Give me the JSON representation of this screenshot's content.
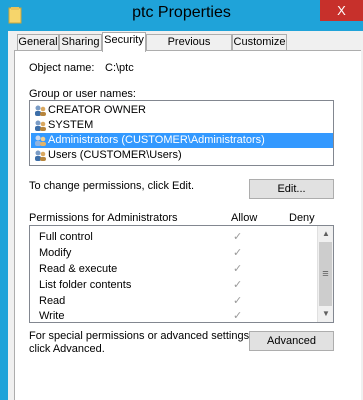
{
  "window": {
    "title": "ptc Properties",
    "close_glyph": "X"
  },
  "tabs": [
    {
      "label": "General"
    },
    {
      "label": "Sharing"
    },
    {
      "label": "Security",
      "active": true
    },
    {
      "label": "Previous Versions"
    },
    {
      "label": "Customize"
    }
  ],
  "object": {
    "label": "Object name:",
    "value": "C:\\ptc"
  },
  "groups": {
    "label": "Group or user names:",
    "items": [
      {
        "name": "CREATOR OWNER",
        "selected": false
      },
      {
        "name": "SYSTEM",
        "selected": false
      },
      {
        "name": "Administrators (CUSTOMER\\Administrators)",
        "selected": true
      },
      {
        "name": "Users (CUSTOMER\\Users)",
        "selected": false
      }
    ]
  },
  "change_note": "To change permissions, click Edit.",
  "edit_button": "Edit...",
  "permissions": {
    "label": "Permissions for Administrators",
    "allow_header": "Allow",
    "deny_header": "Deny",
    "rows": [
      {
        "name": "Full control",
        "allow": "✓",
        "deny": ""
      },
      {
        "name": "Modify",
        "allow": "✓",
        "deny": ""
      },
      {
        "name": "Read & execute",
        "allow": "✓",
        "deny": ""
      },
      {
        "name": "List folder contents",
        "allow": "✓",
        "deny": ""
      },
      {
        "name": "Read",
        "allow": "✓",
        "deny": ""
      },
      {
        "name": "Write",
        "allow": "✓",
        "deny": ""
      }
    ]
  },
  "special_note_line1": "For special permissions or advanced settings,",
  "special_note_line2": "click Advanced.",
  "advanced_button": "Advanced",
  "scroll_up_glyph": "▲",
  "scroll_down_glyph": "▼",
  "scroll_thumb_glyph": "≡",
  "colors": {
    "titlebar": "#1fa3d9",
    "selection": "#3399ff",
    "close": "#c7302b"
  }
}
